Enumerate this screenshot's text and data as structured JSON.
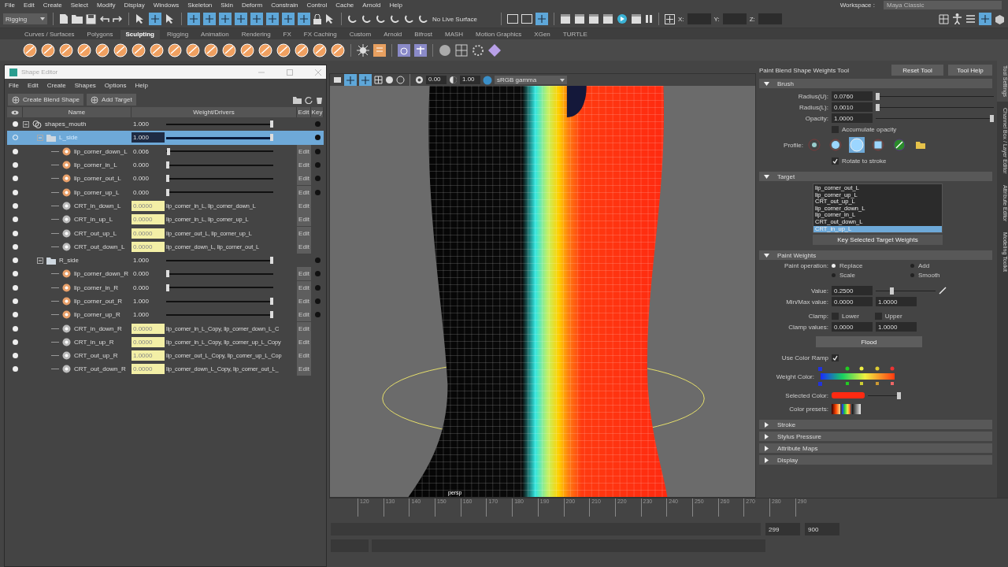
{
  "menu_bar": [
    "File",
    "Edit",
    "Create",
    "Select",
    "Modify",
    "Display",
    "Windows",
    "Skeleton",
    "Skin",
    "Deform",
    "Constrain",
    "Control",
    "Cache",
    "Arnold",
    "Help"
  ],
  "workspace": {
    "label": "Workspace :",
    "value": "Maya Classic"
  },
  "status_line": {
    "menu_set": "Rigging",
    "live_surface": "No Live Surface",
    "coordinates": [
      "X:",
      "Y:",
      "Z:"
    ]
  },
  "shelf_tabs": [
    {
      "label": "Curves / Surfaces",
      "selected": false
    },
    {
      "label": "Polygons",
      "selected": false
    },
    {
      "label": "Sculpting",
      "selected": true
    },
    {
      "label": "Rigging",
      "selected": false
    },
    {
      "label": "Animation",
      "selected": false
    },
    {
      "label": "Rendering",
      "selected": false
    },
    {
      "label": "FX",
      "selected": false
    },
    {
      "label": "FX Caching",
      "selected": false
    },
    {
      "label": "Custom",
      "selected": false
    },
    {
      "label": "Arnold",
      "selected": false
    },
    {
      "label": "Bifrost",
      "selected": false
    },
    {
      "label": "MASH",
      "selected": false
    },
    {
      "label": "Motion Graphics",
      "selected": false
    },
    {
      "label": "XGen",
      "selected": false
    },
    {
      "label": "TURTLE",
      "selected": false
    }
  ],
  "shape_editor": {
    "title": "Shape Editor",
    "menu": [
      "File",
      "Edit",
      "Create",
      "Shapes",
      "Options",
      "Help"
    ],
    "buttons": [
      "Create Blend Shape",
      "Add Target"
    ],
    "columns": [
      "Name",
      "Weight/Drivers",
      "Edit",
      "Key"
    ],
    "rows": [
      {
        "kind": "blendshape",
        "name": "shapes_mouth",
        "weight": "1.000",
        "level": 1,
        "selected": false,
        "expanded": true,
        "children": [
          {
            "kind": "group",
            "name": "L_side",
            "weight": "1.000",
            "level": 1,
            "selected": true,
            "expanded": true,
            "children": [
              {
                "kind": "target",
                "name": "lip_corner_down_L",
                "weight": "0.006",
                "level": 0.006,
                "edit": "Edit",
                "selected": false
              },
              {
                "kind": "target",
                "name": "lip_corner_in_L",
                "weight": "0.000",
                "level": 0,
                "edit": "Edit",
                "selected": false
              },
              {
                "kind": "target",
                "name": "lip_corner_out_L",
                "weight": "0.000",
                "level": 0,
                "edit": "Edit",
                "selected": false
              },
              {
                "kind": "target",
                "name": "lip_corner_up_L",
                "weight": "0.000",
                "level": 0,
                "edit": "Edit",
                "selected": false
              },
              {
                "kind": "combination",
                "name": "CRT_in_down_L",
                "weight": "0.0000",
                "drivers": "lip_corner_in_L, lip_corner_down_L",
                "edit": "Edit",
                "selected": false
              },
              {
                "kind": "combination",
                "name": "CRT_in_up_L",
                "weight": "0.0000",
                "drivers": "lip_corner_in_L, lip_corner_up_L",
                "edit": "Edit",
                "selected": false
              },
              {
                "kind": "combination",
                "name": "CRT_out_up_L",
                "weight": "0.0000",
                "drivers": "lip_corner_out_L, lip_corner_up_L",
                "edit": "Edit",
                "selected": false
              },
              {
                "kind": "combination",
                "name": "CRT_out_down_L",
                "weight": "0.0000",
                "drivers": "lip_corner_down_L, lip_corner_out_L",
                "edit": "Edit",
                "selected": false
              }
            ]
          },
          {
            "kind": "group",
            "name": "R_side",
            "weight": "1.000",
            "level": 1,
            "selected": false,
            "expanded": true,
            "children": [
              {
                "kind": "target",
                "name": "lip_corner_down_R",
                "weight": "0.000",
                "level": 0,
                "edit": "Edit",
                "selected": false
              },
              {
                "kind": "target",
                "name": "lip_corner_in_R",
                "weight": "0.000",
                "level": 0,
                "edit": "Edit",
                "selected": false
              },
              {
                "kind": "target",
                "name": "lip_corner_out_R",
                "weight": "1.000",
                "level": 1,
                "edit": "Edit",
                "selected": false
              },
              {
                "kind": "target",
                "name": "lip_corner_up_R",
                "weight": "1.000",
                "level": 1,
                "edit": "Edit",
                "selected": false
              },
              {
                "kind": "combination",
                "name": "CRT_in_down_R",
                "weight": "0.0000",
                "drivers": "lip_corner_in_L_Copy, lip_corner_down_L_C",
                "edit": "Edit",
                "selected": false
              },
              {
                "kind": "combination",
                "name": "CRT_in_up_R",
                "weight": "0.0000",
                "drivers": "lip_corner_in_L_Copy, lip_corner_up_L_Copy",
                "edit": "Edit",
                "selected": false
              },
              {
                "kind": "combination",
                "name": "CRT_out_up_R",
                "weight": "1.0000",
                "drivers": "lip_corner_out_L_Copy, lip_corner_up_L_Cop",
                "edit": "Edit",
                "selected": false
              },
              {
                "kind": "combination",
                "name": "CRT_out_down_R",
                "weight": "0.0000",
                "drivers": "lip_corner_down_L_Copy, lip_corner_out_L_",
                "edit": "Edit",
                "selected": false
              }
            ]
          }
        ]
      }
    ]
  },
  "viewport": {
    "toolbar_values": [
      "0.00",
      "1.00"
    ],
    "color_space": "sRGB gamma",
    "camera": "persp"
  },
  "tool_settings": {
    "title": "Paint Blend Shape Weights Tool",
    "buttons": [
      "Reset Tool",
      "Tool Help"
    ],
    "brush": {
      "title": "Brush",
      "expanded": true,
      "fields": [
        {
          "label": "Radius(U):",
          "value": "0.0760",
          "level": 0.0
        },
        {
          "label": "Radius(L):",
          "value": "0.0010",
          "level": 0.0
        },
        {
          "label": "Opacity:",
          "value": "1.0000",
          "level": 1
        }
      ],
      "accumulate": {
        "label": "Accumulate opacity",
        "checked": false
      },
      "profile_label": "Profile:",
      "profiles": [
        {
          "kind": "gaussian",
          "selected": false
        },
        {
          "kind": "soft",
          "selected": false
        },
        {
          "kind": "solid",
          "selected": true
        },
        {
          "kind": "square",
          "selected": false
        },
        {
          "kind": "image",
          "selected": false
        },
        {
          "kind": "browse",
          "selected": false
        }
      ],
      "rotate": {
        "label": "Rotate to stroke",
        "checked": true
      }
    },
    "target": {
      "title": "Target",
      "expanded": true,
      "items": [
        {
          "label": "lip_corner_out_L",
          "selected": false
        },
        {
          "label": "lip_corner_up_L",
          "selected": false
        },
        {
          "label": "CRT_out_up_L",
          "selected": false
        },
        {
          "label": "lip_corner_down_L",
          "selected": false
        },
        {
          "label": "lip_corner_in_L",
          "selected": false
        },
        {
          "label": "CRT_out_down_L",
          "selected": false
        },
        {
          "label": "CRT_in_up_L",
          "selected": true
        }
      ],
      "button": "Key Selected Target Weights"
    },
    "paint_weights": {
      "title": "Paint Weights",
      "expanded": true,
      "operation_label": "Paint operation:",
      "operations": [
        {
          "label": "Replace",
          "selected": true
        },
        {
          "label": "Add",
          "selected": false
        },
        {
          "label": "Scale",
          "selected": false
        },
        {
          "label": "Smooth",
          "selected": false
        }
      ],
      "value": {
        "label": "Value:",
        "value": "0.2500",
        "level": 0.25
      },
      "minmax": {
        "label": "Min/Max value:",
        "values": [
          "0.0000",
          "1.0000"
        ]
      },
      "clamp": {
        "label": "Clamp:",
        "options": [
          {
            "label": "Lower",
            "checked": false
          },
          {
            "label": "Upper",
            "checked": false
          }
        ]
      },
      "clamp_values": {
        "label": "Clamp values:",
        "values": [
          "0.0000",
          "1.0000"
        ]
      },
      "flood": "Flood",
      "color_ramp": {
        "label": "Use Color Ramp",
        "checked": true
      },
      "weight_color_label": "Weight Color:",
      "selected_color": {
        "label": "Selected Color:",
        "color": "#ff2a12",
        "level": 1
      },
      "presets_label": "Color presets:"
    },
    "collapsed_sections": [
      {
        "title": "Stroke",
        "expanded": false
      },
      {
        "title": "Stylus Pressure",
        "expanded": false
      },
      {
        "title": "Attribute Maps",
        "expanded": false
      },
      {
        "title": "Display",
        "expanded": false
      }
    ]
  },
  "side_tabs": [
    {
      "label": "Tool Settings",
      "selected": true
    },
    {
      "label": "Channel Box / Layer Editor",
      "selected": false
    },
    {
      "label": "Attribute Editor",
      "selected": false
    },
    {
      "label": "Modeling Toolkit",
      "selected": false
    }
  ],
  "timeline": {
    "ticks": [
      "120",
      "130",
      "140",
      "150",
      "160",
      "170",
      "180",
      "190",
      "200",
      "210",
      "220",
      "230",
      "240",
      "250",
      "260",
      "270",
      "280",
      "290"
    ],
    "range": [
      "299",
      "900"
    ]
  }
}
